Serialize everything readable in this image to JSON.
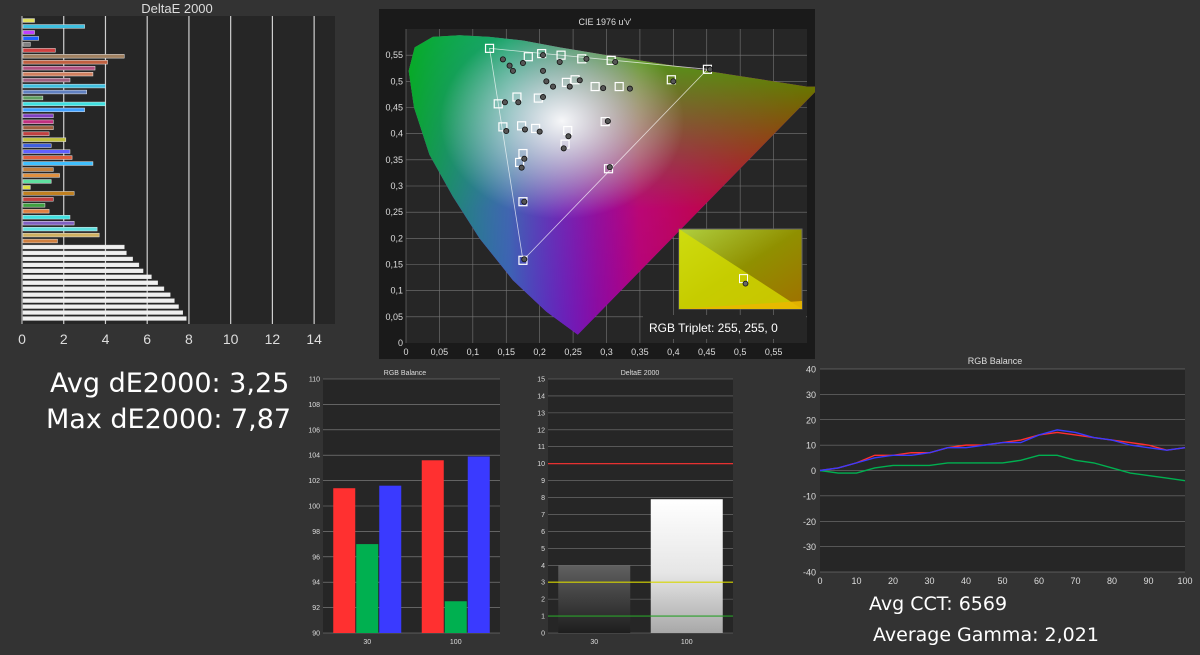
{
  "stats": {
    "avg_de": "Avg dE2000: 3,25",
    "max_de": "Max dE2000: 7,87",
    "avg_cct": "Avg CCT: 6569",
    "avg_gamma": "Average Gamma: 2,021"
  },
  "cie": {
    "rgb_triplet": "RGB Triplet: 255, 255, 0"
  },
  "colors": {
    "panel_bg": "#262626",
    "page_bg": "#333333",
    "red": "#ff3030",
    "green": "#00b050",
    "blue": "#3a3aff",
    "threshold_yellow": "#d6d600",
    "threshold_green": "#2aa02a"
  },
  "chart_data": [
    {
      "id": "deltae_bars",
      "type": "bar",
      "orientation": "horizontal",
      "title": "DeltaE 2000",
      "xlim": [
        0,
        15
      ],
      "x_ticks": [
        0,
        2,
        4,
        6,
        8,
        10,
        12,
        14
      ],
      "x_tick_labels": [
        "0",
        "2",
        "4",
        "6",
        "8",
        "10",
        "12",
        "14"
      ],
      "grid": true,
      "values": [
        0.6,
        3,
        0.6,
        0.8,
        0.4,
        1.6,
        4.9,
        4.1,
        3.5,
        3.4,
        2.3,
        4,
        3.1,
        1,
        4,
        3,
        1.5,
        1.5,
        1.5,
        1.3,
        2.1,
        1.4,
        2.3,
        2.4,
        3.4,
        1.5,
        1.8,
        1.4,
        0.4,
        2.5,
        1.5,
        1.1,
        1.3,
        2.3,
        2.5,
        3.6,
        3.7,
        1.7,
        4.9,
        5,
        5.3,
        5.6,
        5.8,
        6.2,
        6.5,
        6.8,
        7.1,
        7.3,
        7.5,
        7.7,
        7.87
      ],
      "colors": [
        "#e0e060",
        "#40c0e0",
        "#c040ff",
        "#2060ff",
        "#808080",
        "#d04040",
        "#a08060",
        "#c06040",
        "#b05080",
        "#d08060",
        "#a06080",
        "#40c0e0",
        "#6080c0",
        "#60a060",
        "#40e0e0",
        "#40a0ff",
        "#8040c0",
        "#c03080",
        "#a06040",
        "#c04040",
        "#c0c040",
        "#4060e0",
        "#6060ff",
        "#e06040",
        "#40c0ff",
        "#c08040",
        "#e09040",
        "#60e0a0",
        "#e0e040",
        "#c08020",
        "#c04040",
        "#40a040",
        "#e08040",
        "#40e0e0",
        "#8060c0",
        "#60e0e0",
        "#d0b060",
        "#d08040",
        "#f0f0f0",
        "#f0f0f0",
        "#f0f0f0",
        "#f0f0f0",
        "#f0f0f0",
        "#f0f0f0",
        "#f0f0f0",
        "#f0f0f0",
        "#f0f0f0",
        "#f0f0f0",
        "#f0f0f0",
        "#f0f0f0",
        "#f0f0f0"
      ]
    },
    {
      "id": "cie_uv",
      "type": "scatter",
      "title": "CIE 1976 u'v'",
      "xlim": [
        0,
        0.6
      ],
      "ylim": [
        0,
        0.6
      ],
      "x_ticks": [
        0,
        0.05,
        0.1,
        0.15,
        0.2,
        0.25,
        0.3,
        0.35,
        0.4,
        0.45,
        0.5,
        0.55
      ],
      "x_tick_labels": [
        "0",
        "0,05",
        "0,1",
        "0,15",
        "0,2",
        "0,25",
        "0,3",
        "0,35",
        "0,4",
        "0,45",
        "0,5",
        "0,55"
      ],
      "y_ticks": [
        0.05,
        0.1,
        0.15,
        0.2,
        0.25,
        0.3,
        0.35,
        0.4,
        0.45,
        0.5,
        0.55
      ],
      "y_tick_labels": [
        "0,05",
        "0,1",
        "0,15",
        "0,2",
        "0,25",
        "0,3",
        "0,35",
        "0,4",
        "0,45",
        "0,5",
        "0,55"
      ],
      "gamut_triangle": [
        [
          0.451,
          0.523
        ],
        [
          0.125,
          0.563
        ],
        [
          0.175,
          0.158
        ]
      ],
      "targets": [
        [
          0.125,
          0.563
        ],
        [
          0.183,
          0.547
        ],
        [
          0.203,
          0.553
        ],
        [
          0.232,
          0.55
        ],
        [
          0.263,
          0.543
        ],
        [
          0.307,
          0.54
        ],
        [
          0.451,
          0.523
        ],
        [
          0.397,
          0.503
        ],
        [
          0.319,
          0.49
        ],
        [
          0.283,
          0.49
        ],
        [
          0.253,
          0.503
        ],
        [
          0.24,
          0.498
        ],
        [
          0.198,
          0.468
        ],
        [
          0.166,
          0.47
        ],
        [
          0.138,
          0.457
        ],
        [
          0.145,
          0.413
        ],
        [
          0.173,
          0.415
        ],
        [
          0.194,
          0.41
        ],
        [
          0.242,
          0.406
        ],
        [
          0.238,
          0.38
        ],
        [
          0.298,
          0.423
        ],
        [
          0.175,
          0.362
        ],
        [
          0.17,
          0.345
        ],
        [
          0.303,
          0.333
        ],
        [
          0.175,
          0.27
        ],
        [
          0.175,
          0.158
        ]
      ],
      "measured": [
        [
          0.145,
          0.542
        ],
        [
          0.175,
          0.535
        ],
        [
          0.205,
          0.55
        ],
        [
          0.23,
          0.537
        ],
        [
          0.27,
          0.543
        ],
        [
          0.313,
          0.537
        ],
        [
          0.455,
          0.523
        ],
        [
          0.4,
          0.5
        ],
        [
          0.335,
          0.486
        ],
        [
          0.295,
          0.487
        ],
        [
          0.26,
          0.502
        ],
        [
          0.245,
          0.49
        ],
        [
          0.205,
          0.47
        ],
        [
          0.168,
          0.46
        ],
        [
          0.148,
          0.46
        ],
        [
          0.15,
          0.405
        ],
        [
          0.178,
          0.408
        ],
        [
          0.2,
          0.404
        ],
        [
          0.243,
          0.395
        ],
        [
          0.236,
          0.372
        ],
        [
          0.302,
          0.424
        ],
        [
          0.177,
          0.352
        ],
        [
          0.173,
          0.335
        ],
        [
          0.305,
          0.336
        ],
        [
          0.177,
          0.27
        ],
        [
          0.177,
          0.16
        ],
        [
          0.16,
          0.52
        ],
        [
          0.205,
          0.52
        ],
        [
          0.22,
          0.49
        ],
        [
          0.21,
          0.5
        ],
        [
          0.155,
          0.53
        ]
      ],
      "inset_point": [
        0.505,
        0.123
      ]
    },
    {
      "id": "rgb_balance_bars",
      "type": "bar",
      "title": "RGB Balance",
      "categories": [
        "30",
        "100"
      ],
      "ylim": [
        90,
        110
      ],
      "y_ticks": [
        90,
        92,
        94,
        96,
        98,
        100,
        102,
        104,
        106,
        108,
        110
      ],
      "series": [
        {
          "color": "#ff3030",
          "values": [
            101.4,
            103.6
          ]
        },
        {
          "color": "#00b050",
          "values": [
            97,
            92.5
          ]
        },
        {
          "color": "#3a3aff",
          "values": [
            101.6,
            103.9
          ]
        }
      ]
    },
    {
      "id": "deltae_gray",
      "type": "bar",
      "title": "DeltaE 2000",
      "categories": [
        "30",
        "100"
      ],
      "values": [
        4,
        7.9
      ],
      "ylim": [
        0,
        15
      ],
      "y_ticks": [
        0,
        1,
        2,
        3,
        4,
        5,
        6,
        7,
        8,
        9,
        10,
        11,
        12,
        13,
        14,
        15
      ],
      "reference_lines": [
        {
          "value": 10,
          "color": "#ff3030"
        },
        {
          "value": 3,
          "color": "#d6d600"
        },
        {
          "value": 1,
          "color": "#2aa02a"
        }
      ]
    },
    {
      "id": "rgb_balance_lines",
      "type": "line",
      "title": "RGB Balance",
      "x": [
        0,
        5,
        10,
        15,
        20,
        25,
        30,
        35,
        40,
        45,
        50,
        55,
        60,
        65,
        70,
        75,
        80,
        85,
        90,
        95,
        100
      ],
      "xlim": [
        0,
        100
      ],
      "ylim": [
        -40,
        40
      ],
      "x_ticks": [
        0,
        10,
        20,
        30,
        40,
        50,
        60,
        70,
        80,
        90,
        100
      ],
      "y_ticks": [
        -40,
        -30,
        -20,
        -10,
        0,
        10,
        20,
        30,
        40
      ],
      "series": [
        {
          "color": "#ff3030",
          "values": [
            0,
            1,
            3,
            6,
            6,
            7,
            7,
            9,
            10,
            10,
            11,
            12,
            14,
            15,
            14,
            13,
            12,
            11,
            10,
            8,
            9
          ]
        },
        {
          "color": "#00b050",
          "values": [
            0,
            -1,
            -1,
            1,
            2,
            2,
            2,
            3,
            3,
            3,
            3,
            4,
            6,
            6,
            4,
            3,
            1,
            -1,
            -2,
            -3,
            -4
          ]
        },
        {
          "color": "#3a3aff",
          "values": [
            0,
            1,
            3,
            5,
            6,
            6,
            7,
            9,
            9,
            10,
            11,
            11,
            14,
            16,
            15,
            13,
            12,
            10,
            9,
            8,
            9
          ]
        }
      ]
    }
  ]
}
